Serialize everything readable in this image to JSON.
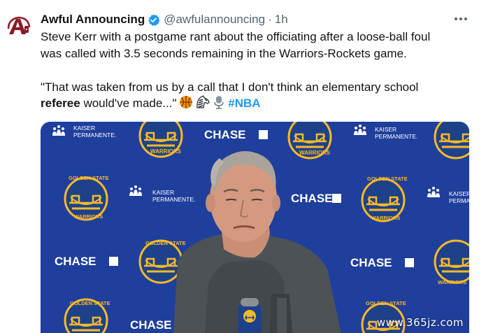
{
  "account": {
    "display_name": "Awful Announcing",
    "handle": "@awfulannouncing",
    "separator": "·",
    "time": "1h",
    "avatar_icon": "awful-announcing-logo",
    "verified_icon": "verified-badge-icon",
    "verified_color": "#1d9bf0"
  },
  "tweet": {
    "line1": "Steve Kerr with a postgame rant about the officiating after a loose-ball foul",
    "line2": "was called with 3.5 seconds remaining in the Warriors-Rockets game.",
    "quote_part1": "\"That was taken from us by a call that I don't think an elementary school",
    "quote_bold": "referee",
    "quote_part2": " would've made...\"",
    "emojis": [
      "basketball-icon",
      "zebra-icon",
      "microphone-icon"
    ],
    "hashtag": "#NBA",
    "hashtag_color": "#1d9bf0"
  },
  "media": {
    "backdrop_color": "#1f3f9c",
    "sponsor_chase": "CHASE",
    "sponsor_kaiser_line1": "KAISER",
    "sponsor_kaiser_line2": "PERMANENTE.",
    "sponsor_kaiser_partial": "PERMA",
    "team_top": "GOLDEN STATE",
    "team_bottom": "WARRIORS",
    "team_gold": "#fdb927",
    "watermark": "www.365jz.com"
  },
  "colors": {
    "text": "#0f1419",
    "secondary": "#536471"
  }
}
